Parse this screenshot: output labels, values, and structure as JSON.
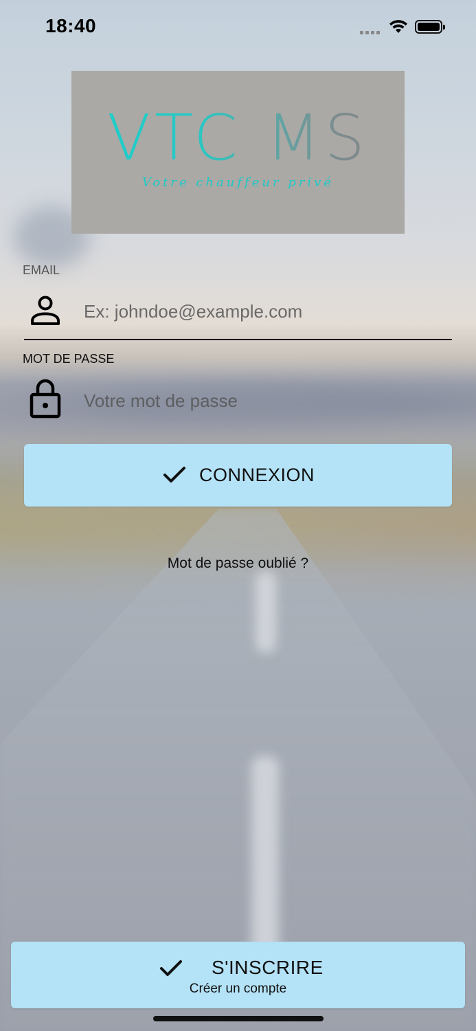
{
  "status_bar": {
    "time": "18:40"
  },
  "logo": {
    "title": "VTC MS",
    "subtitle": "Votre chauffeur privé",
    "colors": {
      "background": "#aba9a5",
      "accent": "#19d0cc"
    }
  },
  "form": {
    "email": {
      "label": "EMAIL",
      "placeholder": "Ex: johndoe@example.com",
      "value": "",
      "icon": "person-icon"
    },
    "password": {
      "label": "MOT DE PASSE",
      "placeholder": "Votre mot de passe",
      "value": "",
      "icon": "lock-icon"
    },
    "login_button": {
      "label": "CONNEXION",
      "icon": "checkmark-icon"
    },
    "forgot_link": "Mot de passe oublié ?"
  },
  "signup": {
    "label": "S'INSCRIRE",
    "sublabel": "Créer un compte",
    "icon": "checkmark-icon"
  },
  "colors": {
    "button_background": "#b4e2f7",
    "text": "#111111"
  }
}
